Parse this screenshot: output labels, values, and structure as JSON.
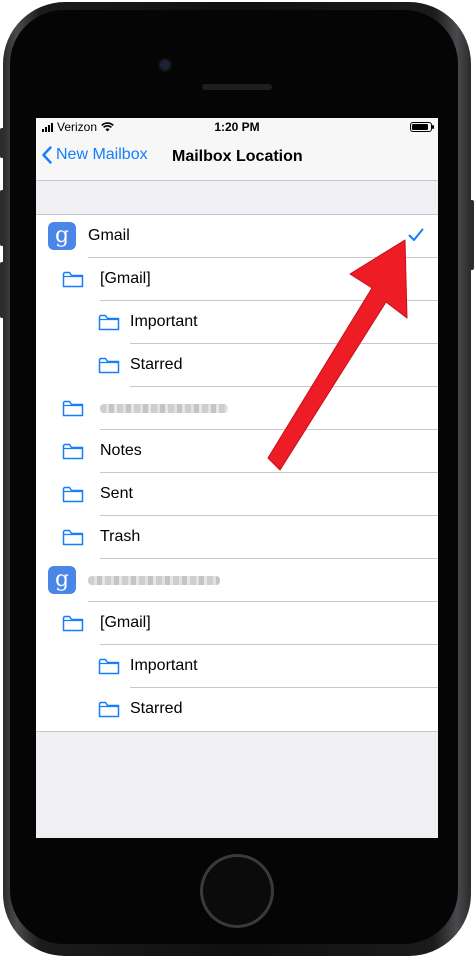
{
  "status_bar": {
    "carrier": "Verizon",
    "time": "1:20 PM",
    "battery_level": 0.9
  },
  "nav": {
    "back_label": "New Mailbox",
    "title": "Mailbox Location"
  },
  "colors": {
    "accent": "#147efb",
    "gmail_icon": "#4a86e8",
    "arrow": "#ee1c25"
  },
  "rows": [
    {
      "label": "Gmail",
      "icon": "google-account-icon",
      "selected": true
    },
    {
      "label": "[Gmail]",
      "icon": "folder-icon"
    },
    {
      "label": "Important",
      "icon": "folder-icon"
    },
    {
      "label": "Starred",
      "icon": "folder-icon"
    },
    {
      "label": "",
      "icon": "folder-icon",
      "obscured": true
    },
    {
      "label": "Notes",
      "icon": "folder-icon"
    },
    {
      "label": "Sent",
      "icon": "folder-icon"
    },
    {
      "label": "Trash",
      "icon": "folder-icon"
    },
    {
      "label": "",
      "icon": "google-account-icon",
      "obscured": true
    },
    {
      "label": "[Gmail]",
      "icon": "folder-icon"
    },
    {
      "label": "Important",
      "icon": "folder-icon"
    },
    {
      "label": "Starred",
      "icon": "folder-icon"
    }
  ]
}
